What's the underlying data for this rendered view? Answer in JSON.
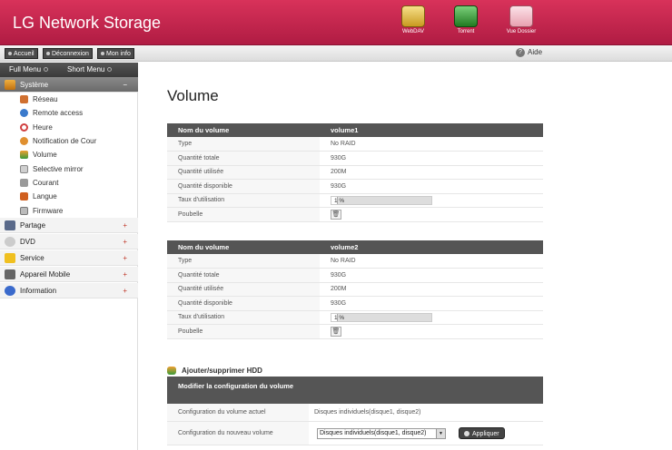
{
  "header": {
    "brand": "LG Network Storage",
    "shortcuts": [
      {
        "label": "WebDAV",
        "icon": "webdav-icon"
      },
      {
        "label": "Torrent",
        "icon": "torrent-icon"
      },
      {
        "label": "Vue Dossier",
        "icon": "folder-view-icon"
      }
    ]
  },
  "toolbar": {
    "buttons": [
      "Accueil",
      "Déconnexion",
      "Mon info"
    ],
    "help": "Aide"
  },
  "menu": {
    "tabs": [
      "Full Menu",
      "Short Menu"
    ]
  },
  "sidebar": {
    "active_category": "Système",
    "sub_items": [
      "Réseau",
      "Remote access",
      "Heure",
      "Notification de Cour",
      "Volume",
      "Selective mirror",
      "Courant",
      "Langue",
      "Firmware"
    ],
    "categories": [
      "Partage",
      "DVD",
      "Service",
      "Appareil Mobile",
      "Information"
    ]
  },
  "page": {
    "title": "Volume"
  },
  "volumes": [
    {
      "header_label": "Nom du volume",
      "name": "volume1",
      "rows": [
        {
          "label": "Type",
          "value": "No RAID"
        },
        {
          "label": "Quantité totale",
          "value": "930G"
        },
        {
          "label": "Quantité utilisée",
          "value": "200M"
        },
        {
          "label": "Quantité disponible",
          "value": "930G"
        }
      ],
      "usage_label": "Taux d'utilisation",
      "usage_text": "1 %",
      "usage_fraction": 0.01,
      "trash_label": "Poubelle"
    },
    {
      "header_label": "Nom du volume",
      "name": "volume2",
      "rows": [
        {
          "label": "Type",
          "value": "No RAID"
        },
        {
          "label": "Quantité totale",
          "value": "930G"
        },
        {
          "label": "Quantité utilisée",
          "value": "200M"
        },
        {
          "label": "Quantité disponible",
          "value": "930G"
        }
      ],
      "usage_label": "Taux d'utilisation",
      "usage_text": "1 %",
      "usage_fraction": 0.01,
      "trash_label": "Poubelle"
    }
  ],
  "hdd": {
    "title": "Ajouter/supprimer HDD",
    "config_header": "Modifier la configuration du volume",
    "current_label": "Configuration du volume actuel",
    "current_value": "Disques individuels(disque1, disque2)",
    "new_label": "Configuration du nouveau volume",
    "new_value": "Disques individuels(disque1, disque2)",
    "apply_label": "Appliquer"
  },
  "colors": {
    "header": "#c82a50",
    "dark": "#555555"
  }
}
